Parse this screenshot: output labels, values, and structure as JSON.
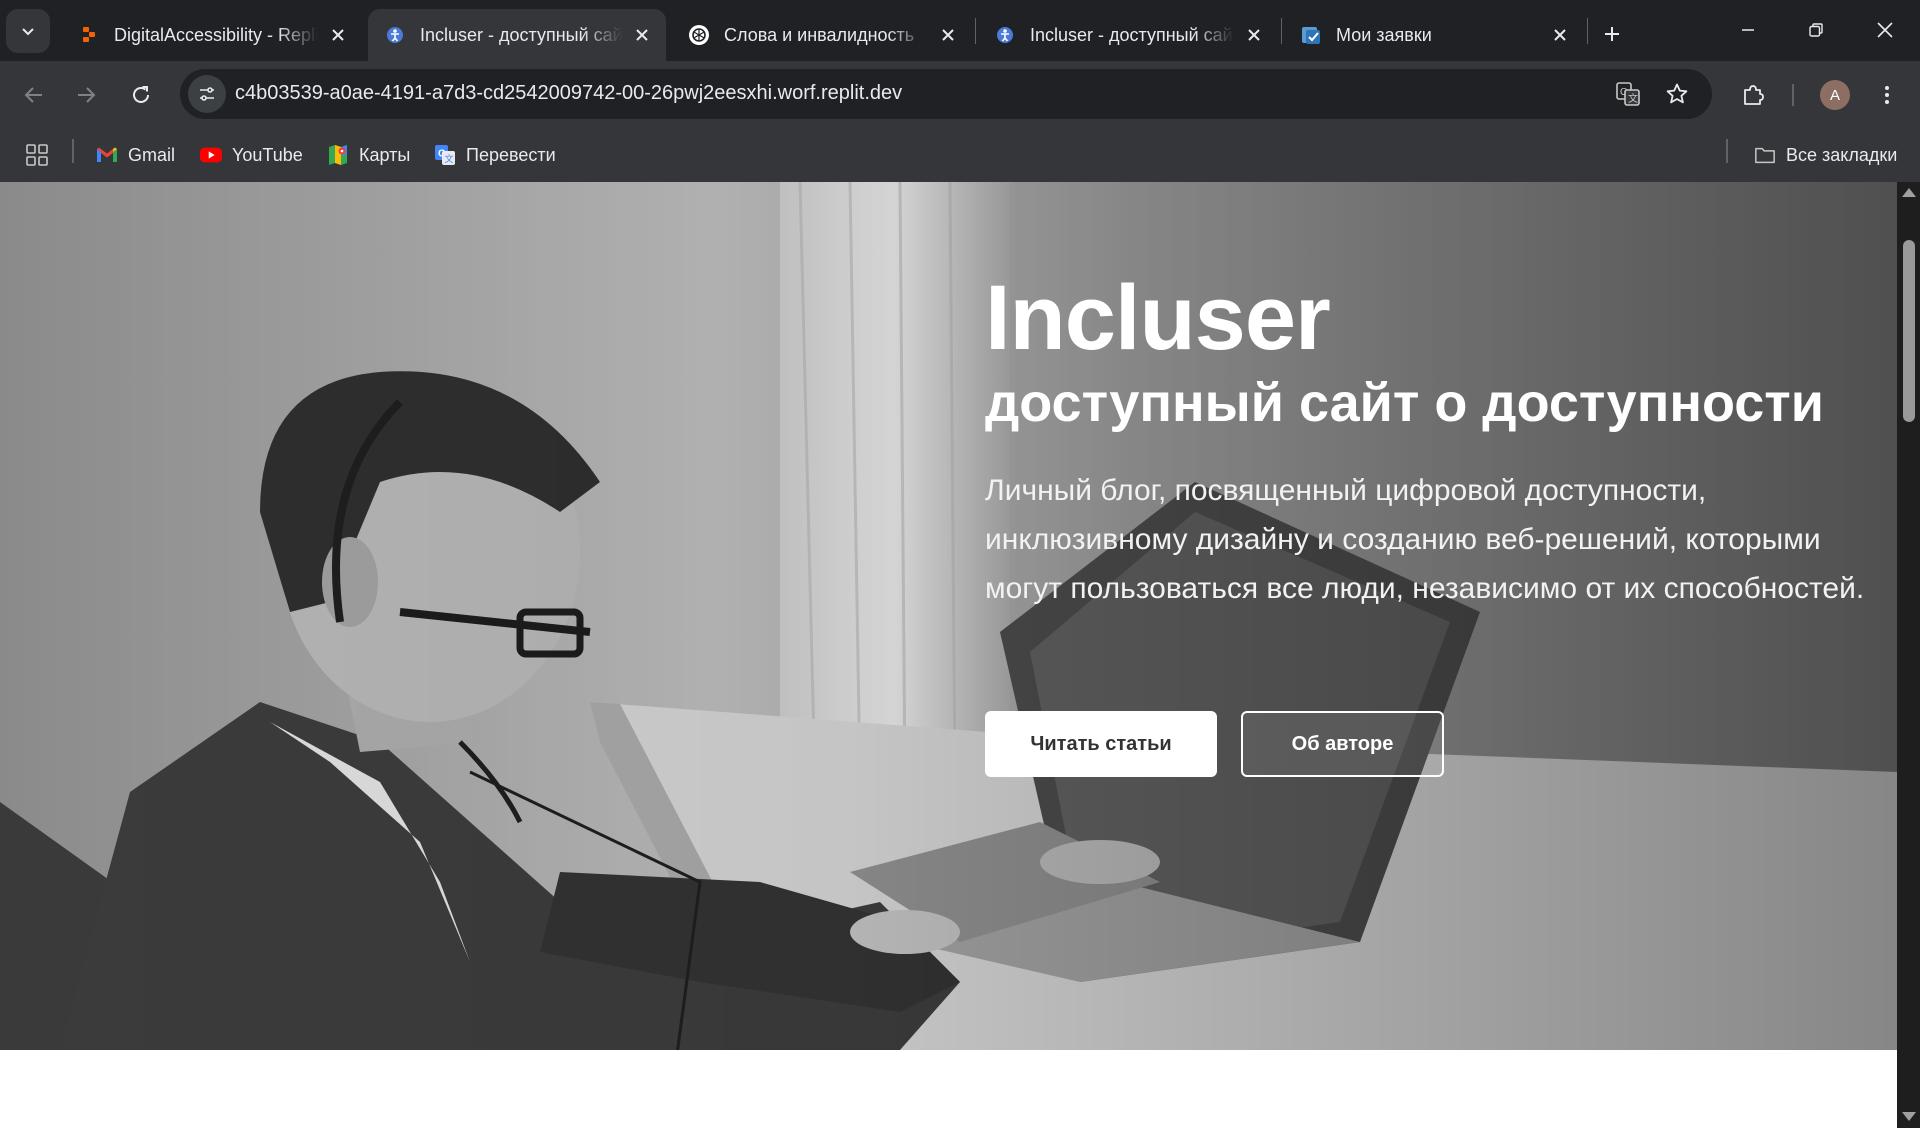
{
  "browser": {
    "tabs": [
      {
        "title": "DigitalAccessibility - Replit",
        "favicon": "replit-icon",
        "active": false
      },
      {
        "title": "Incluser - доступный сайт о доступности",
        "favicon": "incluser-icon",
        "active": true
      },
      {
        "title": "Слова и инвалидность",
        "favicon": "chatgpt-icon",
        "active": false
      },
      {
        "title": "Incluser - доступный сайт о доступности",
        "favicon": "incluser-icon",
        "active": false
      },
      {
        "title": "Мои заявки",
        "favicon": "tasks-icon",
        "active": false
      }
    ],
    "url": "c4b03539-a0ae-4191-a7d3-cd2542009742-00-26pwj2eesxhi.worf.replit.dev",
    "avatar_letter": "A",
    "bookmarks": [
      {
        "label": "Gmail",
        "icon": "gmail-icon"
      },
      {
        "label": "YouTube",
        "icon": "youtube-icon"
      },
      {
        "label": "Карты",
        "icon": "maps-icon"
      },
      {
        "label": "Перевести",
        "icon": "translate-icon"
      }
    ],
    "all_bookmarks_label": "Все закладки",
    "colors": {
      "tabstrip": "#202124",
      "toolbar": "#35363a",
      "omnibox": "#202124",
      "text": "#e8eaed"
    }
  },
  "hero": {
    "title": "Incluser",
    "subtitle": "доступный сайт о доступности",
    "description": "Личный блог, посвященный цифровой доступности, инклюзивному дизайну и созданию веб-решений, которыми могут пользоваться все люди, независимо от их способностей.",
    "primary_button": "Читать статьи",
    "secondary_button": "Об авторе",
    "image": "grayscale photo of a man in glasses with a headset working at a laptop"
  }
}
